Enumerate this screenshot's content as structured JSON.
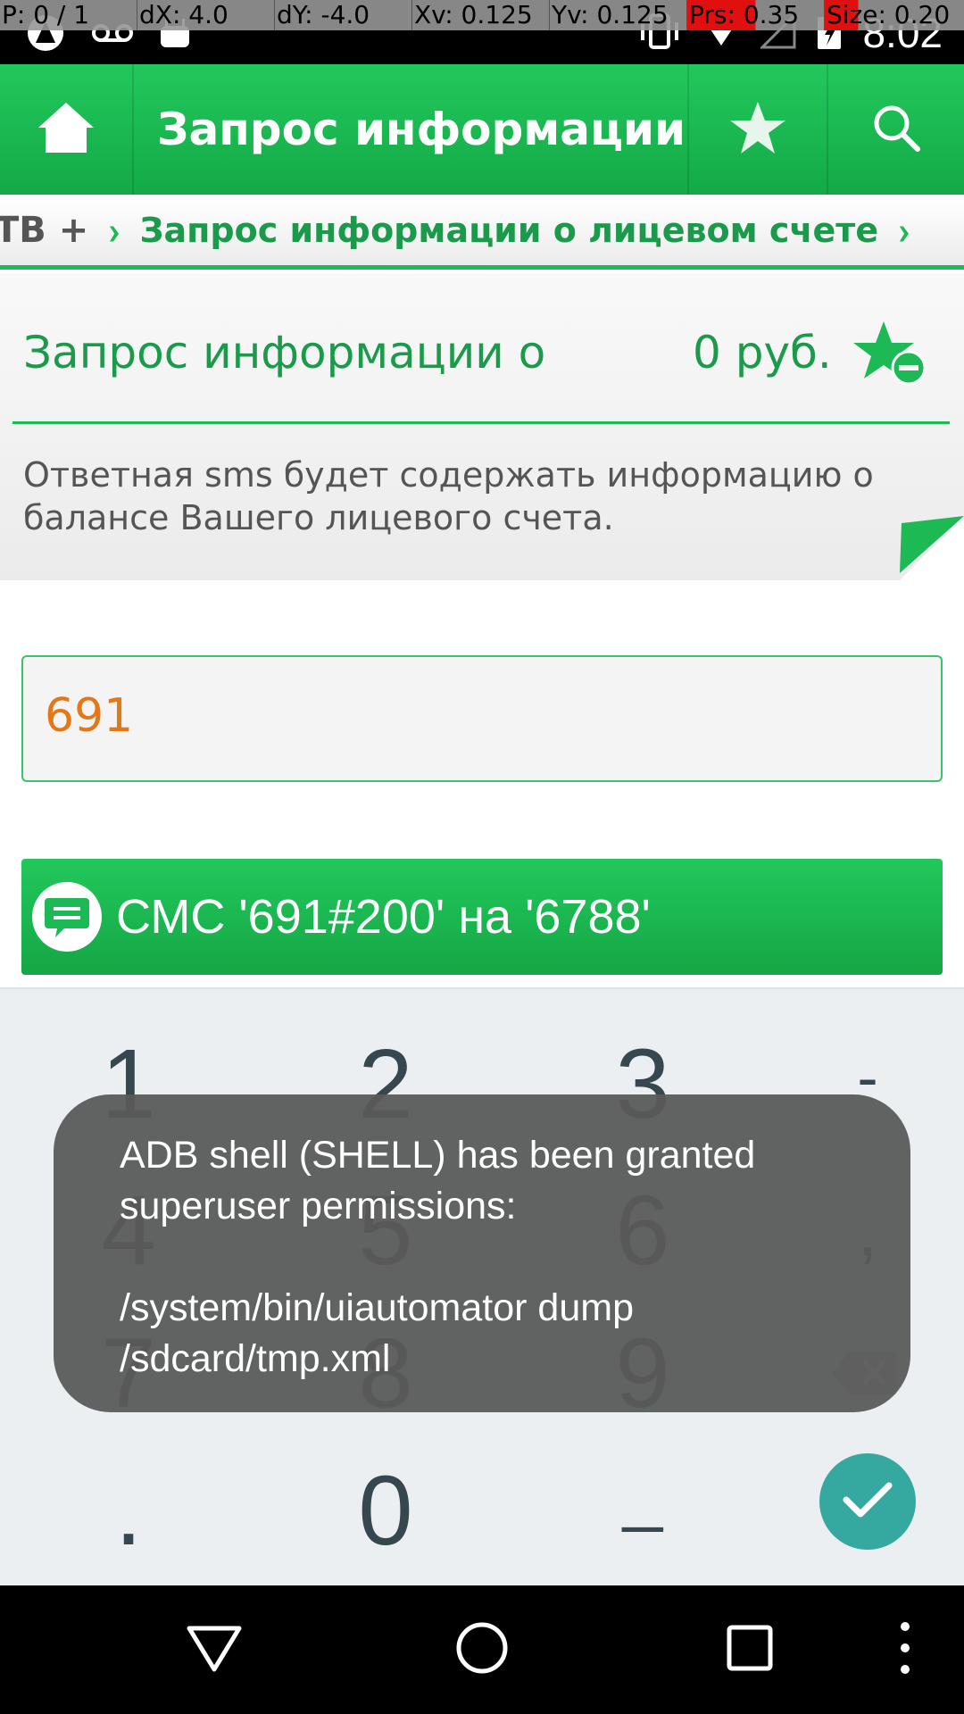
{
  "status_bar": {
    "pointer_location": {
      "p": "P: 0 / 1",
      "dx": "dX: 4.0",
      "dy": "dY: -4.0",
      "xv": "Xv: 0.125",
      "yv": "Yv: 0.125",
      "prs": "Prs: 0.35",
      "size": "Size: 0.20"
    },
    "time": "8:02",
    "icons_left": [
      "app-notification-icon",
      "voicemail-icon",
      "android-icon"
    ],
    "icons_right": [
      "vibrate-icon",
      "wifi-icon",
      "signal-icon",
      "battery-icon"
    ]
  },
  "app_bar": {
    "title": "Запрос информации ...",
    "icons": [
      "home-icon",
      "star-icon",
      "search-icon"
    ]
  },
  "breadcrumb": {
    "previous": "ТВ +",
    "current": "Запрос информации о лицевом счете"
  },
  "card": {
    "title": "Запрос информации о",
    "price": "0 руб.",
    "description": "Ответная sms будет содержать информацию о балансе Вашего лицевого счета."
  },
  "input": {
    "value": "691"
  },
  "sms_button": {
    "label": "СМС '691#200' на '6788'"
  },
  "keyboard": {
    "keys": [
      "1",
      "2",
      "3",
      "-",
      "4",
      "5",
      "6",
      ",",
      "7",
      "8",
      "9",
      ".",
      "0",
      "_"
    ]
  },
  "toast": {
    "message": "ADB shell (SHELL) has been granted superuser permissions:\n\n/system/bin/uiautomator dump /sdcard/tmp.xml"
  },
  "colors": {
    "brand_green": "#1db954",
    "title_green": "#1a9a4a",
    "input_value": "#e57716",
    "done_key": "#35a9a0"
  }
}
